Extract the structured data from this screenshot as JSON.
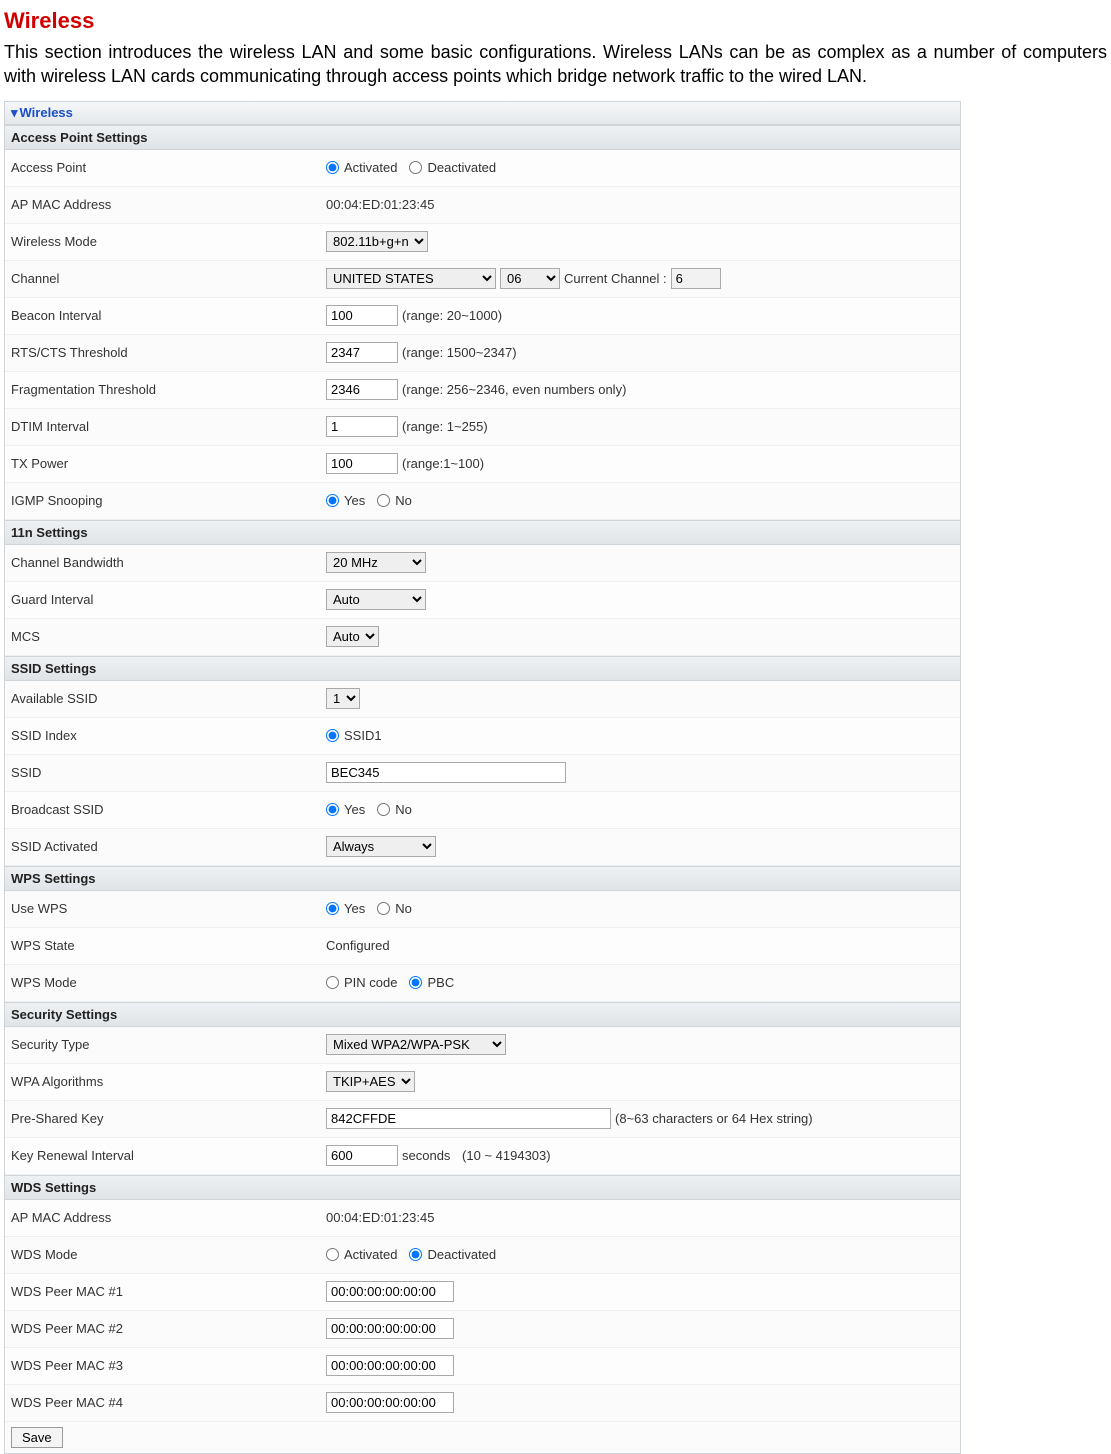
{
  "page": {
    "title": "Wireless",
    "intro": "This section introduces the wireless LAN and some basic configurations. Wireless LANs can be as complex as a number of computers with wireless LAN cards communicating through access points which bridge network traffic to the wired LAN."
  },
  "title_bar": "Wireless",
  "sections": {
    "ap": {
      "header": "Access Point Settings",
      "access_point": {
        "label": "Access Point",
        "opt_activated": "Activated",
        "opt_deactivated": "Deactivated"
      },
      "ap_mac": {
        "label": "AP MAC Address",
        "value": "00:04:ED:01:23:45"
      },
      "wireless_mode": {
        "label": "Wireless Mode",
        "value": "802.11b+g+n"
      },
      "channel": {
        "label": "Channel",
        "country": "UNITED STATES",
        "ch": "06",
        "current_label": "Current Channel :",
        "current": "6"
      },
      "beacon": {
        "label": "Beacon Interval",
        "value": "100",
        "hint": "(range: 20~1000)"
      },
      "rts": {
        "label": "RTS/CTS Threshold",
        "value": "2347",
        "hint": "(range: 1500~2347)"
      },
      "frag": {
        "label": "Fragmentation Threshold",
        "value": "2346",
        "hint": "(range: 256~2346, even numbers only)"
      },
      "dtim": {
        "label": "DTIM Interval",
        "value": "1",
        "hint": "(range: 1~255)"
      },
      "txpower": {
        "label": "TX Power",
        "value": "100",
        "hint": "(range:1~100)"
      },
      "igmp": {
        "label": "IGMP Snooping",
        "opt_yes": "Yes",
        "opt_no": "No"
      }
    },
    "n11": {
      "header": "11n Settings",
      "bw": {
        "label": "Channel Bandwidth",
        "value": "20 MHz"
      },
      "gi": {
        "label": "Guard Interval",
        "value": "Auto"
      },
      "mcs": {
        "label": "MCS",
        "value": "Auto"
      }
    },
    "ssid": {
      "header": "SSID Settings",
      "avail": {
        "label": "Available SSID",
        "value": "1"
      },
      "index": {
        "label": "SSID Index",
        "opt1": "SSID1"
      },
      "ssid": {
        "label": "SSID",
        "value": "BEC345"
      },
      "broadcast": {
        "label": "Broadcast SSID",
        "opt_yes": "Yes",
        "opt_no": "No"
      },
      "activated": {
        "label": "SSID Activated",
        "value": "Always"
      }
    },
    "wps": {
      "header": "WPS Settings",
      "use": {
        "label": "Use WPS",
        "opt_yes": "Yes",
        "opt_no": "No"
      },
      "state": {
        "label": "WPS State",
        "value": "Configured"
      },
      "mode": {
        "label": "WPS Mode",
        "opt_pin": "PIN code",
        "opt_pbc": "PBC"
      }
    },
    "sec": {
      "header": "Security Settings",
      "type": {
        "label": "Security Type",
        "value": "Mixed WPA2/WPA-PSK"
      },
      "alg": {
        "label": "WPA Algorithms",
        "value": "TKIP+AES"
      },
      "psk": {
        "label": "Pre-Shared Key",
        "value": "842CFFDE",
        "hint": "(8~63 characters or 64 Hex string)"
      },
      "renew": {
        "label": "Key Renewal Interval",
        "value": "600",
        "unit": "seconds",
        "hint": "(10 ~ 4194303)"
      }
    },
    "wds": {
      "header": "WDS Settings",
      "apmac": {
        "label": "AP MAC Address",
        "value": "00:04:ED:01:23:45"
      },
      "mode": {
        "label": "WDS Mode",
        "opt_activated": "Activated",
        "opt_deactivated": "Deactivated"
      },
      "peer1": {
        "label": "WDS Peer MAC #1",
        "value": "00:00:00:00:00:00"
      },
      "peer2": {
        "label": "WDS Peer MAC #2",
        "value": "00:00:00:00:00:00"
      },
      "peer3": {
        "label": "WDS Peer MAC #3",
        "value": "00:00:00:00:00:00"
      },
      "peer4": {
        "label": "WDS Peer MAC #4",
        "value": "00:00:00:00:00:00"
      }
    }
  },
  "save_label": "Save"
}
